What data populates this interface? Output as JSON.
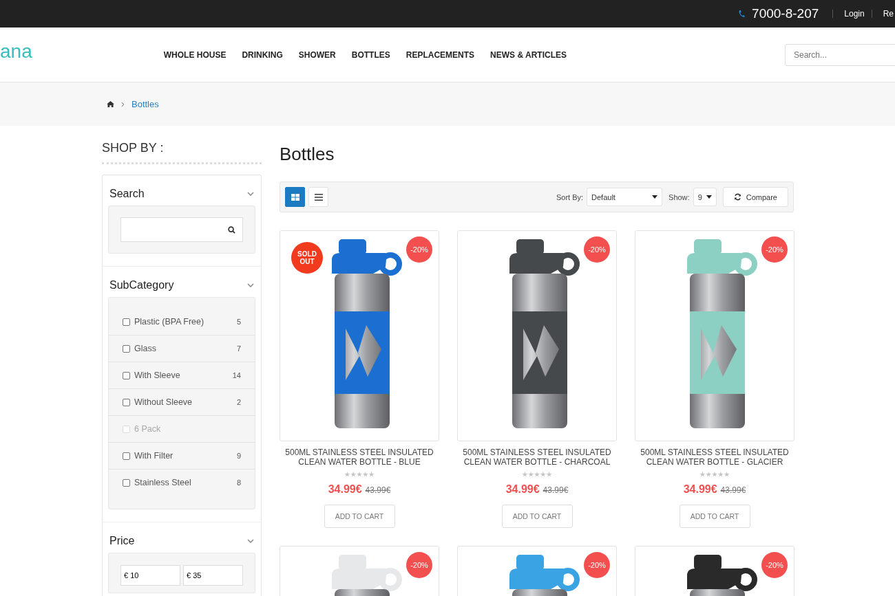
{
  "top_bar": {
    "phone": "7000-8-207",
    "links": [
      "Login",
      "Re"
    ]
  },
  "header": {
    "logo": "ana",
    "nav": [
      "WHOLE HOUSE",
      "DRINKING",
      "SHOWER",
      "BOTTLES",
      "REPLACEMENTS",
      "NEWS & ARTICLES"
    ],
    "search": {
      "placeholder": "Search..."
    }
  },
  "breadcrumb": {
    "current": "Bottles"
  },
  "sidebar": {
    "title": "SHOP BY :",
    "search": {
      "title": "Search",
      "expanded": true
    },
    "subcategory": {
      "title": "SubCategory",
      "expanded": true,
      "items": [
        {
          "label": "Plastic (BPA Free)",
          "count": "5",
          "checked": false,
          "disabled": false
        },
        {
          "label": "Glass",
          "count": "7",
          "checked": false,
          "disabled": false
        },
        {
          "label": "With Sleeve",
          "count": "14",
          "checked": false,
          "disabled": false
        },
        {
          "label": "Without Sleeve",
          "count": "2",
          "checked": false,
          "disabled": false
        },
        {
          "label": "6 Pack",
          "checked": false,
          "disabled": true
        },
        {
          "label": "With Filter",
          "count": "9",
          "checked": false,
          "disabled": false
        },
        {
          "label": "Stainless Steel",
          "count": "8",
          "checked": false,
          "disabled": false
        }
      ]
    },
    "price": {
      "title": "Price",
      "expanded": true,
      "min": "€ 10",
      "max": "€ 35"
    }
  },
  "main": {
    "title": "Bottles",
    "toolbar": {
      "views": [
        {
          "kind": "grid",
          "selected": true
        },
        {
          "kind": "list",
          "selected": false
        }
      ],
      "sort_label": "Sort By:",
      "sort_value": "Default",
      "show_label": "Show:",
      "show_value": "9",
      "compare": "Compare"
    },
    "products": [
      {
        "title": "500ML STAINLESS STEEL INSULATED CLEAN WATER BOTTLE - BLUE",
        "color": "#1a6fd0",
        "badge": "SOLD OUT",
        "discount": "-20%",
        "stars": 0,
        "price": "34.99€",
        "old_price": "43.99€",
        "button": "ADD TO CART"
      },
      {
        "title": "500ML STAINLESS STEEL INSULATED CLEAN WATER BOTTLE - CHARCOAL",
        "color": "#45494c",
        "discount": "-20%",
        "stars": 0,
        "price": "34.99€",
        "old_price": "43.99€",
        "button": "ADD TO CART"
      },
      {
        "title": "500ML STAINLESS STEEL INSULATED CLEAN WATER BOTTLE - GLACIER",
        "color": "#8ccfc3",
        "discount": "-20%",
        "stars": 0,
        "price": "34.99€",
        "old_price": "43.99€",
        "button": "ADD TO CART"
      },
      {
        "color": "#e6e8e9",
        "discount": "-20%"
      },
      {
        "color": "#3aa3e3",
        "discount": "-20%"
      },
      {
        "color": "#2a2a2a",
        "discount": "-20%"
      }
    ]
  }
}
